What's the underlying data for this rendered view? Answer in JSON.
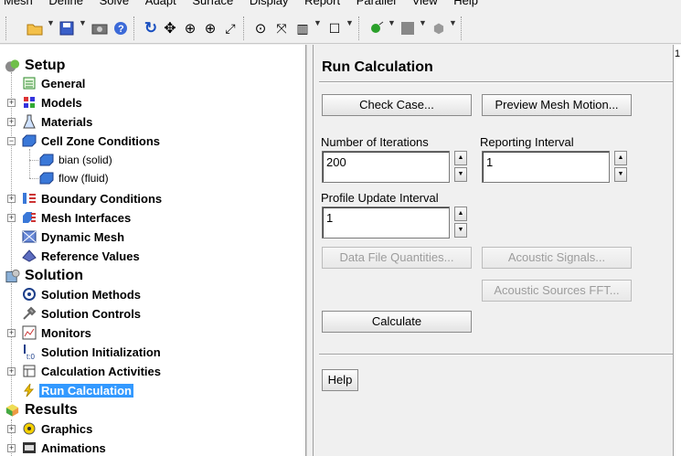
{
  "menubar": {
    "items": [
      "Mesh",
      "Define",
      "Solve",
      "Adapt",
      "Surface",
      "Display",
      "Report",
      "Parallel",
      "View",
      "Help"
    ]
  },
  "tree": {
    "setup": "Setup",
    "general": "General",
    "models": "Models",
    "materials": "Materials",
    "cell_zone": "Cell Zone Conditions",
    "bian": "bian (solid)",
    "flow": "flow (fluid)",
    "boundary": "Boundary Conditions",
    "mesh_interfaces": "Mesh Interfaces",
    "dynamic_mesh": "Dynamic Mesh",
    "reference_values": "Reference Values",
    "solution": "Solution",
    "solution_methods": "Solution Methods",
    "solution_controls": "Solution Controls",
    "monitors": "Monitors",
    "solution_init": "Solution Initialization",
    "calc_activities": "Calculation Activities",
    "run_calc": "Run Calculation",
    "results": "Results",
    "graphics": "Graphics",
    "animations": "Animations"
  },
  "task": {
    "title": "Run Calculation",
    "check_case": "Check Case...",
    "preview_mesh_motion": "Preview Mesh Motion...",
    "iterations_label": "Number of Iterations",
    "iterations_value": "200",
    "reporting_label": "Reporting Interval",
    "reporting_value": "1",
    "profile_label": "Profile Update Interval",
    "profile_value": "1",
    "data_file_quantities": "Data File Quantities...",
    "acoustic_signals": "Acoustic Signals...",
    "acoustic_fft": "Acoustic Sources FFT...",
    "calculate": "Calculate",
    "help": "Help"
  },
  "right_edge": {
    "label": "1"
  },
  "colors": {
    "selection": "#3399ff",
    "panel": "#f0f0f0"
  }
}
